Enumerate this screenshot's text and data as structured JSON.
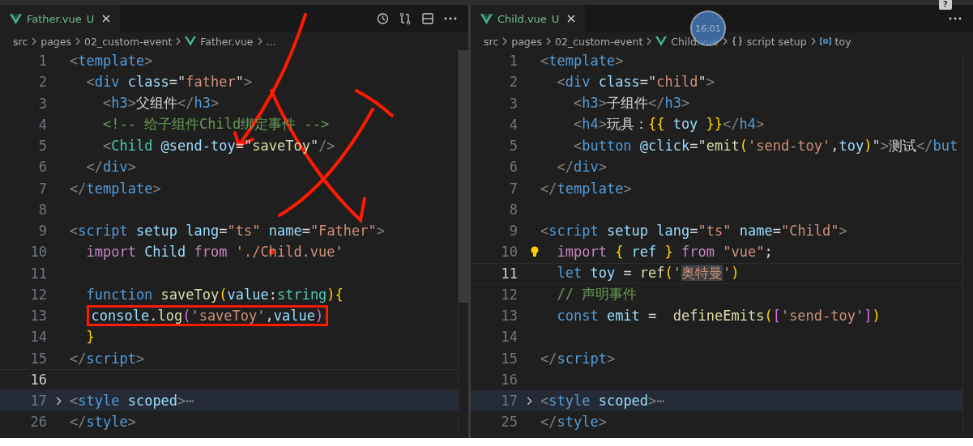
{
  "help_badge": "?",
  "recording_clock": "16:01",
  "panes": [
    {
      "tab": {
        "label": "Father.vue",
        "status": "U",
        "selected": true
      },
      "breadcrumb": [
        {
          "label": "src",
          "kind": "path"
        },
        {
          "label": "pages",
          "kind": "path"
        },
        {
          "label": "02_custom-event",
          "kind": "path"
        },
        {
          "label": "Father.vue",
          "kind": "file"
        },
        {
          "label": "...",
          "kind": "path"
        }
      ],
      "lines": [
        {
          "number": "1",
          "kind": "plain",
          "tokens": [
            {
              "text": "<",
              "kind": "punct"
            },
            {
              "text": "template",
              "kind": "tag"
            },
            {
              "text": ">",
              "kind": "punct"
            }
          ]
        },
        {
          "number": "2",
          "kind": "plain",
          "tokens": [
            {
              "text": "  <",
              "kind": "punct"
            },
            {
              "text": "div",
              "kind": "tag"
            },
            {
              "text": " class",
              "kind": "attr"
            },
            {
              "text": "=\"",
              "kind": "text"
            },
            {
              "text": "father",
              "kind": "string"
            },
            {
              "text": "\"",
              "kind": "text"
            },
            {
              "text": ">",
              "kind": "punct"
            }
          ]
        },
        {
          "number": "3",
          "kind": "plain",
          "tokens": [
            {
              "text": "    <",
              "kind": "punct"
            },
            {
              "text": "h3",
              "kind": "tag"
            },
            {
              "text": ">",
              "kind": "punct"
            },
            {
              "text": "父组件",
              "kind": "text"
            },
            {
              "text": "</",
              "kind": "punct"
            },
            {
              "text": "h3",
              "kind": "tag"
            },
            {
              "text": ">",
              "kind": "punct"
            }
          ]
        },
        {
          "number": "4",
          "kind": "plain",
          "tokens": [
            {
              "text": "    <!-- 给子组件Child绑定事件 -->",
              "kind": "comment"
            }
          ]
        },
        {
          "number": "5",
          "kind": "plain",
          "tokens": [
            {
              "text": "    <",
              "kind": "punct"
            },
            {
              "text": "Child",
              "kind": "component"
            },
            {
              "text": " @send-toy",
              "kind": "attr"
            },
            {
              "text": "=\"",
              "kind": "text"
            },
            {
              "text": "saveToy",
              "kind": "func"
            },
            {
              "text": "\"",
              "kind": "text"
            },
            {
              "text": "/>",
              "kind": "punct"
            }
          ]
        },
        {
          "number": "6",
          "kind": "plain",
          "tokens": [
            {
              "text": "  </",
              "kind": "punct"
            },
            {
              "text": "div",
              "kind": "tag"
            },
            {
              "text": ">",
              "kind": "punct"
            }
          ]
        },
        {
          "number": "7",
          "kind": "plain",
          "tokens": [
            {
              "text": "</",
              "kind": "punct"
            },
            {
              "text": "template",
              "kind": "tag"
            },
            {
              "text": ">",
              "kind": "punct"
            }
          ]
        },
        {
          "number": "8",
          "kind": "plain"
        },
        {
          "number": "9",
          "kind": "plain",
          "tokens": [
            {
              "text": "<",
              "kind": "punct"
            },
            {
              "text": "script",
              "kind": "tag"
            },
            {
              "text": " setup lang",
              "kind": "attr"
            },
            {
              "text": "=",
              "kind": "text"
            },
            {
              "text": "\"ts\"",
              "kind": "string"
            },
            {
              "text": " name",
              "kind": "attr"
            },
            {
              "text": "=",
              "kind": "text"
            },
            {
              "text": "\"Father\"",
              "kind": "string"
            },
            {
              "text": ">",
              "kind": "punct"
            }
          ]
        },
        {
          "number": "10",
          "kind": "plain",
          "tokens": [
            {
              "text": "  import",
              "kind": "keyword"
            },
            {
              "text": " Child ",
              "kind": "var"
            },
            {
              "text": "from",
              "kind": "keyword"
            },
            {
              "text": " './Child.vue'",
              "kind": "string"
            }
          ]
        },
        {
          "number": "11",
          "kind": "plain"
        },
        {
          "number": "12",
          "kind": "plain",
          "tokens": [
            {
              "text": "  function",
              "kind": "storage"
            },
            {
              "text": " saveToy",
              "kind": "func"
            },
            {
              "text": "(",
              "kind": "bracket1"
            },
            {
              "text": "value",
              "kind": "var"
            },
            {
              "text": ":",
              "kind": "text"
            },
            {
              "text": "string",
              "kind": "type"
            },
            {
              "text": ")",
              "kind": "bracket1"
            },
            {
              "text": "{",
              "kind": "bracket1"
            }
          ]
        },
        {
          "number": "13",
          "kind": "boxed",
          "tokens": [
            {
              "text": "console",
              "kind": "var"
            },
            {
              "text": ".",
              "kind": "text"
            },
            {
              "text": "log",
              "kind": "func"
            },
            {
              "text": "(",
              "kind": "bracket2"
            },
            {
              "text": "'saveToy'",
              "kind": "string"
            },
            {
              "text": ",",
              "kind": "text"
            },
            {
              "text": "value",
              "kind": "var"
            },
            {
              "text": ")",
              "kind": "bracket2"
            }
          ]
        },
        {
          "number": "14",
          "kind": "plain",
          "tokens": [
            {
              "text": "  }",
              "kind": "bracket1"
            }
          ]
        },
        {
          "number": "15",
          "kind": "plain",
          "tokens": [
            {
              "text": "</",
              "kind": "punct"
            },
            {
              "text": "script",
              "kind": "tag"
            },
            {
              "text": ">",
              "kind": "punct"
            }
          ]
        },
        {
          "number": "16",
          "kind": "current"
        },
        {
          "number": "17",
          "kind": "folded",
          "tokens": [
            {
              "text": "<",
              "kind": "punct"
            },
            {
              "text": "style",
              "kind": "tag"
            },
            {
              "text": " scoped",
              "kind": "attr"
            },
            {
              "text": ">",
              "kind": "punct"
            },
            {
              "text": "⋯",
              "kind": "punct"
            }
          ]
        },
        {
          "number": "26",
          "kind": "plain",
          "tokens": [
            {
              "text": "</",
              "kind": "punct"
            },
            {
              "text": "style",
              "kind": "tag"
            },
            {
              "text": ">",
              "kind": "punct"
            }
          ]
        }
      ]
    },
    {
      "tab": {
        "label": "Child.vue",
        "status": "U",
        "selected": true
      },
      "breadcrumb": [
        {
          "label": "src",
          "kind": "path"
        },
        {
          "label": "pages",
          "kind": "path"
        },
        {
          "label": "02_custom-event",
          "kind": "path"
        },
        {
          "label": "Child.vue",
          "kind": "file"
        },
        {
          "label": "script setup",
          "kind": "block"
        },
        {
          "label": "toy",
          "kind": "variable"
        }
      ],
      "lines": [
        {
          "number": "1",
          "kind": "plain",
          "tokens": [
            {
              "text": "<",
              "kind": "punct"
            },
            {
              "text": "template",
              "kind": "tag"
            },
            {
              "text": ">",
              "kind": "punct"
            }
          ]
        },
        {
          "number": "2",
          "kind": "plain",
          "tokens": [
            {
              "text": "  <",
              "kind": "punct"
            },
            {
              "text": "div",
              "kind": "tag"
            },
            {
              "text": " class",
              "kind": "attr"
            },
            {
              "text": "=\"",
              "kind": "text"
            },
            {
              "text": "child",
              "kind": "string"
            },
            {
              "text": "\"",
              "kind": "text"
            },
            {
              "text": ">",
              "kind": "punct"
            }
          ]
        },
        {
          "number": "3",
          "kind": "plain",
          "tokens": [
            {
              "text": "    <",
              "kind": "punct"
            },
            {
              "text": "h3",
              "kind": "tag"
            },
            {
              "text": ">",
              "kind": "punct"
            },
            {
              "text": "子组件",
              "kind": "text"
            },
            {
              "text": "</",
              "kind": "punct"
            },
            {
              "text": "h3",
              "kind": "tag"
            },
            {
              "text": ">",
              "kind": "punct"
            }
          ]
        },
        {
          "number": "4",
          "kind": "plain",
          "tokens": [
            {
              "text": "    <",
              "kind": "punct"
            },
            {
              "text": "h4",
              "kind": "tag"
            },
            {
              "text": ">",
              "kind": "punct"
            },
            {
              "text": "玩具：",
              "kind": "text"
            },
            {
              "text": "{{",
              "kind": "bracket1"
            },
            {
              "text": " toy ",
              "kind": "var"
            },
            {
              "text": "}}",
              "kind": "bracket1"
            },
            {
              "text": "</",
              "kind": "punct"
            },
            {
              "text": "h4",
              "kind": "tag"
            },
            {
              "text": ">",
              "kind": "punct"
            }
          ]
        },
        {
          "number": "5",
          "kind": "plain",
          "tokens": [
            {
              "text": "    <",
              "kind": "punct"
            },
            {
              "text": "button",
              "kind": "tag"
            },
            {
              "text": " @click",
              "kind": "attr"
            },
            {
              "text": "=\"",
              "kind": "text"
            },
            {
              "text": "emit",
              "kind": "func"
            },
            {
              "text": "(",
              "kind": "bracket1"
            },
            {
              "text": "'send-toy'",
              "kind": "string"
            },
            {
              "text": ",",
              "kind": "text"
            },
            {
              "text": "toy",
              "kind": "var"
            },
            {
              "text": ")",
              "kind": "bracket1"
            },
            {
              "text": "\"",
              "kind": "text"
            },
            {
              "text": ">",
              "kind": "punct"
            },
            {
              "text": "测试",
              "kind": "text"
            },
            {
              "text": "</",
              "kind": "punct"
            },
            {
              "text": "but",
              "kind": "tag"
            }
          ]
        },
        {
          "number": "6",
          "kind": "plain",
          "tokens": [
            {
              "text": "  </",
              "kind": "punct"
            },
            {
              "text": "div",
              "kind": "tag"
            },
            {
              "text": ">",
              "kind": "punct"
            }
          ]
        },
        {
          "number": "7",
          "kind": "plain",
          "tokens": [
            {
              "text": "</",
              "kind": "punct"
            },
            {
              "text": "template",
              "kind": "tag"
            },
            {
              "text": ">",
              "kind": "punct"
            }
          ]
        },
        {
          "number": "8",
          "kind": "plain"
        },
        {
          "number": "9",
          "kind": "plain",
          "tokens": [
            {
              "text": "<",
              "kind": "punct"
            },
            {
              "text": "script",
              "kind": "tag"
            },
            {
              "text": " setup lang",
              "kind": "attr"
            },
            {
              "text": "=",
              "kind": "text"
            },
            {
              "text": "\"ts\"",
              "kind": "string"
            },
            {
              "text": " name",
              "kind": "attr"
            },
            {
              "text": "=",
              "kind": "text"
            },
            {
              "text": "\"Child\"",
              "kind": "string"
            },
            {
              "text": ">",
              "kind": "punct"
            }
          ]
        },
        {
          "number": "10",
          "kind": "hint",
          "tokens": [
            {
              "text": "  import ",
              "kind": "keyword"
            },
            {
              "text": "{",
              "kind": "bracket1"
            },
            {
              "text": " ref ",
              "kind": "var"
            },
            {
              "text": "}",
              "kind": "bracket1"
            },
            {
              "text": " from",
              "kind": "keyword"
            },
            {
              "text": " \"vue\"",
              "kind": "string"
            },
            {
              "text": ";",
              "kind": "text"
            }
          ]
        },
        {
          "number": "11",
          "kind": "current",
          "tokens": [
            {
              "text": "  let",
              "kind": "storage"
            },
            {
              "text": " toy",
              "kind": "var"
            },
            {
              "text": " = ",
              "kind": "text"
            },
            {
              "text": "ref",
              "kind": "func"
            },
            {
              "text": "(",
              "kind": "bracket1"
            },
            {
              "text": "'",
              "kind": "string"
            },
            {
              "text": "奥特曼",
              "kind": "match"
            },
            {
              "text": "'",
              "kind": "string"
            },
            {
              "text": ")",
              "kind": "bracket1"
            }
          ]
        },
        {
          "number": "12",
          "kind": "plain",
          "tokens": [
            {
              "text": "  // 声明事件",
              "kind": "comment"
            }
          ]
        },
        {
          "number": "13",
          "kind": "plain",
          "tokens": [
            {
              "text": "  const",
              "kind": "storage"
            },
            {
              "text": " emit",
              "kind": "var"
            },
            {
              "text": " =  ",
              "kind": "text"
            },
            {
              "text": "defineEmits",
              "kind": "func"
            },
            {
              "text": "(",
              "kind": "bracket1"
            },
            {
              "text": "[",
              "kind": "bracket2"
            },
            {
              "text": "'send-toy'",
              "kind": "string"
            },
            {
              "text": "]",
              "kind": "bracket2"
            },
            {
              "text": ")",
              "kind": "bracket1"
            }
          ]
        },
        {
          "number": "14",
          "kind": "plain"
        },
        {
          "number": "15",
          "kind": "plain",
          "tokens": [
            {
              "text": "</",
              "kind": "punct"
            },
            {
              "text": "script",
              "kind": "tag"
            },
            {
              "text": ">",
              "kind": "punct"
            }
          ]
        },
        {
          "number": "16",
          "kind": "plain"
        },
        {
          "number": "17",
          "kind": "folded",
          "tokens": [
            {
              "text": "<",
              "kind": "punct"
            },
            {
              "text": "style",
              "kind": "tag"
            },
            {
              "text": " scoped",
              "kind": "attr"
            },
            {
              "text": ">",
              "kind": "punct"
            },
            {
              "text": "⋯",
              "kind": "punct"
            }
          ]
        },
        {
          "number": "25",
          "kind": "plain",
          "tokens": [
            {
              "text": "</",
              "kind": "punct"
            },
            {
              "text": "style",
              "kind": "tag"
            },
            {
              "text": ">",
              "kind": "punct"
            }
          ]
        }
      ]
    }
  ]
}
